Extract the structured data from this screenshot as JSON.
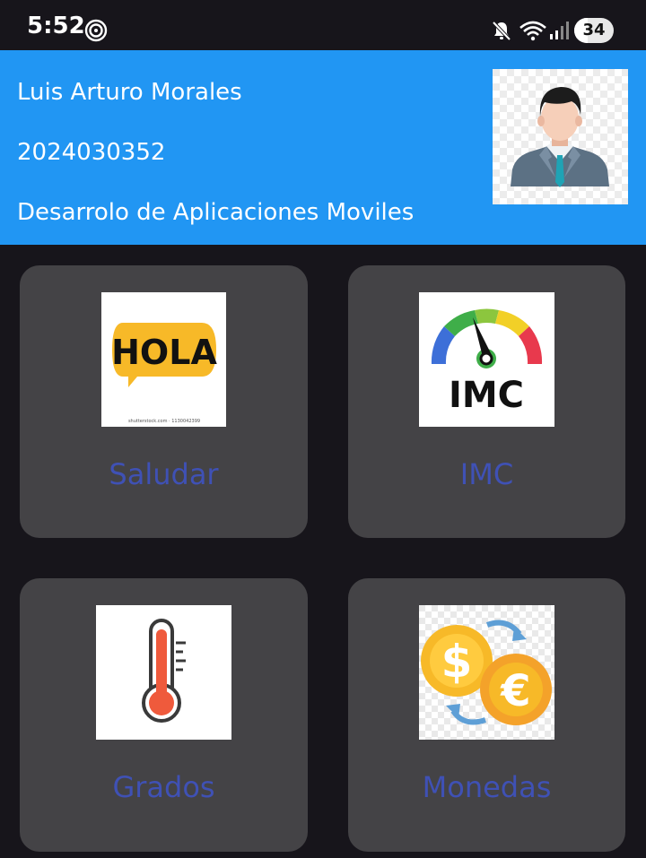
{
  "status_bar": {
    "time": "5:52",
    "battery": "34",
    "battery_level": 0.34,
    "icons": [
      "sync-icon",
      "mute-icon",
      "wifi-icon",
      "signal-icon",
      "battery-icon"
    ]
  },
  "header": {
    "name": "Luis Arturo Morales",
    "student_id": "2024030352",
    "course": "Desarrolo de Aplicaciones Moviles",
    "background_color": "#2196f3"
  },
  "menu": {
    "items": [
      {
        "label": "Saludar",
        "icon": "hola-speech-bubble-icon",
        "image_text": "HOLA",
        "image_caption": "shutterstock.com · 1130042399"
      },
      {
        "label": "IMC",
        "icon": "imc-gauge-icon",
        "image_text": "IMC"
      },
      {
        "label": "Grados",
        "icon": "thermometer-icon"
      },
      {
        "label": "Monedas",
        "icon": "currency-exchange-icon",
        "image_text": [
          "$",
          "€"
        ]
      }
    ],
    "label_color": "#3f51b5",
    "card_color": "#444346"
  }
}
